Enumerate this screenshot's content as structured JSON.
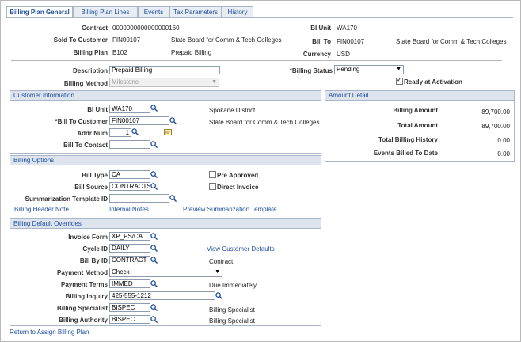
{
  "tabs": [
    "Billing Plan General",
    "Billing Plan Lines",
    "Events",
    "Tax Parameters",
    "History"
  ],
  "header": {
    "contract_label": "Contract",
    "contract": "0000000000000000160",
    "bi_unit_label": "BI Unit",
    "bi_unit": "WA170",
    "sold_to_label": "Sold To Customer",
    "sold_to_id": "FIN00107",
    "sold_to_name": "State Board for Comm & Tech Colleges",
    "bill_to_label": "Bill To",
    "bill_to_id": "FIN00107",
    "bill_to_name": "State Board for Comm & Tech Colleges",
    "billing_plan_label": "Billing Plan",
    "billing_plan_id": "B102",
    "billing_plan_name": "Prepaid Billing",
    "currency_label": "Currency",
    "currency": "USD"
  },
  "general": {
    "description_label": "Description",
    "description": "Prepaid Billing",
    "status_label": "*Billing Status",
    "status": "Pending",
    "method_label": "Billing Method",
    "method": "Milestone",
    "ready_label": "Ready at Activation"
  },
  "customer": {
    "title": "Customer Information",
    "bi_unit_label": "BI Unit",
    "bi_unit": "WA170",
    "bi_unit_desc": "Spokane District",
    "bill_to_label": "*Bill To Customer",
    "bill_to": "FIN00107",
    "bill_to_desc": "State Board for Comm & Tech Colleges",
    "addr_label": "Addr Num",
    "addr": "1",
    "contact_label": "Bill To Contact",
    "contact": ""
  },
  "amount": {
    "title": "Amount Detail",
    "rows": [
      {
        "label": "Billing Amount",
        "value": "89,700.00"
      },
      {
        "label": "Total Amount",
        "value": "89,700.00"
      },
      {
        "label": "Total Billing History",
        "value": "0.00"
      },
      {
        "label": "Events Billed To Date",
        "value": "0.00"
      }
    ]
  },
  "options": {
    "title": "Billing Options",
    "bill_type_label": "Bill Type",
    "bill_type": "CA",
    "bill_source_label": "Bill Source",
    "bill_source": "CONTRACTS",
    "summ_label": "Summarization Template ID",
    "summ": "",
    "pre_approved": "Pre Approved",
    "direct_invoice": "Direct Invoice",
    "link_header_note": "Billing Header Note",
    "link_internal": "Internal Notes",
    "link_preview": "Preview Summarization Template"
  },
  "defaults": {
    "title": "Billing Default Overrides",
    "invoice_form_label": "Invoice Form",
    "invoice_form": "XP_PS/CA",
    "cycle_label": "Cycle ID",
    "cycle": "DAILY",
    "bill_by_label": "Bill By ID",
    "bill_by": "CONTRACT",
    "bill_by_desc": "Contract",
    "view_defaults": "View Customer Defaults",
    "pay_method_label": "Payment Method",
    "pay_method": "Check",
    "pay_terms_label": "Payment Terms",
    "pay_terms": "IMMED",
    "pay_terms_desc": "Due Immediately",
    "inquiry_label": "Billing Inquiry",
    "inquiry": "425-555-1212",
    "specialist_label": "Billing Specialist",
    "specialist": "BISPEC",
    "specialist_desc": "Billing Specialist",
    "authority_label": "Billing Authority",
    "authority": "BISPEC",
    "authority_desc": "Billing Specialist"
  },
  "footer_link": "Return to Assign Billing Plan"
}
